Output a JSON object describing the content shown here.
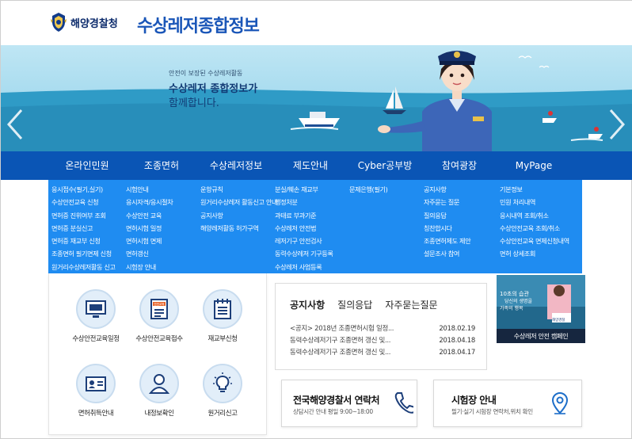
{
  "header": {
    "org_name": "해양경찰청",
    "site_title": "수상레저종합정보"
  },
  "banner": {
    "intro": "안전이 보장된 수상레저활동",
    "headline1": "수상레저 종합정보가",
    "headline2": "함께합니다."
  },
  "gnb": [
    "온라인민원",
    "조종면허",
    "수상레저정보",
    "제도안내",
    "Cyber공부방",
    "참여광장",
    "MyPage"
  ],
  "submenu": [
    [
      "응시접수(필기,실기)",
      "수상안전교육 신청",
      "면허증 진위여부 조회",
      "면허증 분실신고",
      "면허증 재교부 신청",
      "조종면허 필기면제 신청",
      "원거리수상레저활동 신고"
    ],
    [
      "시험안내",
      "응시자격/응시절차",
      "수상안전 교육",
      "면허시험 일정",
      "면허시험 면제",
      "면허갱신",
      "시험장 안내"
    ],
    [
      "운항규칙",
      "원거리수상레저 활동신고 안내",
      "공지사항",
      "해양레저활동 허가구역"
    ],
    [
      "분실/훼손 재교부",
      "행정처분",
      "과태료 부과기준",
      "수상레저 안전법",
      "레저기구 안전검사",
      "동력수상레저 기구등록",
      "수상레저 사업등록"
    ],
    [
      "문제은행(필기)"
    ],
    [
      "공지사항",
      "자주묻는 질문",
      "질의응답",
      "칭찬합시다",
      "조종면허제도 제안",
      "설문조사 참여"
    ],
    [
      "기본정보",
      "민원 처리내역",
      "응시내역 조회/취소",
      "수상안전교육 조회/취소",
      "수상안전교육 면제신청내역",
      "면허 상세조회"
    ]
  ],
  "quick": [
    {
      "label": "수상안전교육일정",
      "icon": "monitor-icon"
    },
    {
      "label": "수상안전교육접수",
      "icon": "education-form-icon",
      "badge": "안전교육"
    },
    {
      "label": "재교부신청",
      "icon": "document-icon"
    },
    {
      "label": "면허취득안내",
      "icon": "id-card-icon"
    },
    {
      "label": "내정보확인",
      "icon": "user-icon"
    },
    {
      "label": "원거리신고",
      "icon": "lightbulb-icon"
    }
  ],
  "notice": {
    "tabs": [
      "공지사항",
      "질의응답",
      "자주묻는질문"
    ],
    "items": [
      {
        "title": "<공지> 2018년 조종면허시험 일정...",
        "date": "2018.02.19"
      },
      {
        "title": "동력수상레저기구 조종면허 갱신 및...",
        "date": "2018.04.18"
      },
      {
        "title": "동력수상레저기구 조종면허 갱신 및...",
        "date": "2018.04.17"
      }
    ]
  },
  "campaign": {
    "caption": "수상레저 안전 캠페인",
    "image_text1": "10초의 습관",
    "image_text2": "당신의 생명을",
    "image_text3": "가족의 행복",
    "boat_label": "해양경찰"
  },
  "contact": {
    "title": "전국해양경찰서 연락처",
    "subtitle": "상담시간 안내   평일 9:00~18:00"
  },
  "testsite": {
    "title": "시험장 안내",
    "subtitle": "필기·실기 시험장 연락처,위치 확인"
  },
  "colors": {
    "gnb": "#0a55b5",
    "submenu": "#1f8cf1",
    "title": "#1a56b8"
  }
}
